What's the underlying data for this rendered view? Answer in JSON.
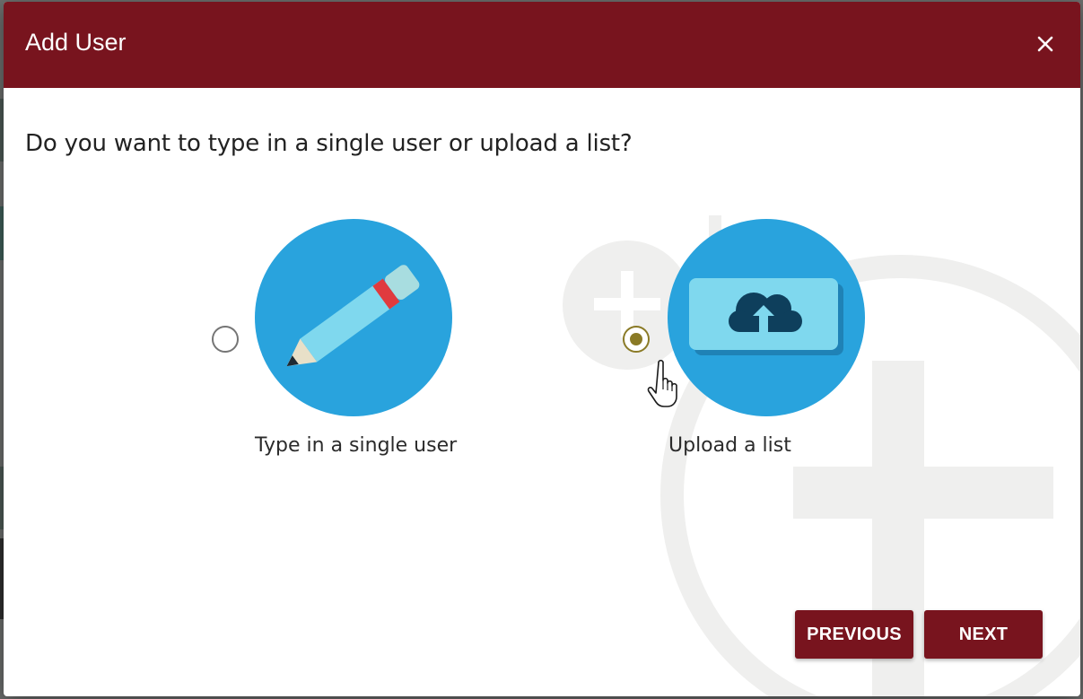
{
  "dialog": {
    "title": "Add User",
    "close_icon": "close-icon",
    "question": "Do you want to type in a single user or upload a list?"
  },
  "options": [
    {
      "label": "Type in a single user",
      "icon": "pencil-icon",
      "selected": false
    },
    {
      "label": "Upload a list",
      "icon": "cloud-upload-icon",
      "selected": true
    }
  ],
  "buttons": {
    "previous": "PREVIOUS",
    "next": "NEXT"
  },
  "colors": {
    "header": "#78141e",
    "accent_blue": "#29a3dd",
    "radio_selected": "#8a7a26"
  }
}
